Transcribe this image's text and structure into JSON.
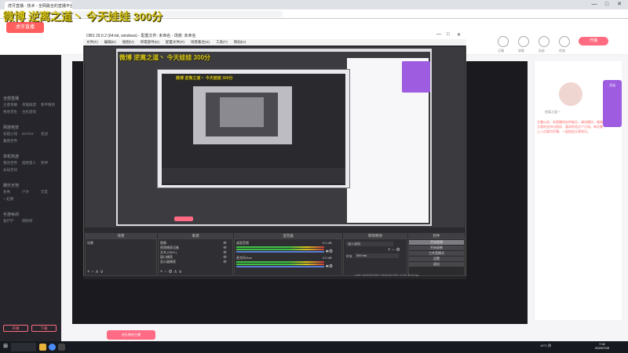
{
  "browser": {
    "tab_title": "虎牙直播 - 技术 - 全网最全的直播平台",
    "url": "huya.com/xxxxxx",
    "window_controls": [
      "—",
      "□",
      "✕"
    ]
  },
  "site": {
    "logo": "虎牙直播",
    "header_labels": [
      "订阅",
      "消息",
      "历史",
      "任务",
      "开播"
    ],
    "start_live_label": "开播"
  },
  "overlay": {
    "top_caption": "微博 逆离之道丶 今天娃娃 300分",
    "inner_caption": "微博 逆离之道丶 今天娃娃 300分",
    "inner_caption_small": "微博 逆离之道丶 今天娃娃 300分"
  },
  "sidebar": {
    "sections": [
      {
        "title": "全部直播",
        "items": [
          "王者荣耀",
          "英雄联盟",
          "和平精英",
          "绝地求生",
          "主机游戏"
        ]
      },
      {
        "title": "网游竞技",
        "items": [
          "穿越火线",
          "DOTA2",
          "逆战",
          "魔兽世界"
        ]
      },
      {
        "title": "单机热游",
        "items": [
          "我的世界",
          "怪物猎人",
          "原神",
          "永劫无间"
        ]
      },
      {
        "title": "娱乐天地",
        "items": [
          "星秀",
          "户外",
          "交友",
          "一起看"
        ]
      },
      {
        "title": "手游休闲",
        "items": [
          "金铲铲",
          "阴阳师"
        ]
      }
    ],
    "bottom_buttons": [
      "开播",
      "下载"
    ]
  },
  "obs": {
    "title": "OBS 29.0.2 (64-bit, windows) - 配置文件: 未命名 - 场景: 未命名",
    "menu": [
      "文件(F)",
      "编辑(E)",
      "视图(V)",
      "停靠部件(D)",
      "配置文件(P)",
      "场景集合(S)",
      "工具(T)",
      "帮助(H)"
    ],
    "docks": {
      "scenes_header": "场景",
      "sources_header": "来源",
      "mixer_header": "混音器",
      "transitions_header": "转场特效",
      "controls_header": "控件"
    },
    "scene_items": [
      "场景"
    ],
    "source_items": [
      "图像",
      "视频捕获设备",
      "文本 (GDI+)",
      "窗口捕获",
      "显示器捕获"
    ],
    "mixer": {
      "track1": "桌面音频",
      "track1_db": "0.0 dB",
      "track2": "麦克风/Aux",
      "track2_db": "0.0 dB"
    },
    "transitions": {
      "type": "淡入淡出",
      "duration_label": "时长",
      "duration_value": "300 ms"
    },
    "controls": [
      "开始直播",
      "开始录制",
      "工作室模式",
      "设置",
      "退出"
    ],
    "status": "LIVE: 00:00:00   REC: 00:00:00   CPU: 1.2%, 30.00 fps"
  },
  "right_panel": {
    "streamer_name": "逆离之道丶",
    "description": "主播公告：本直播间仅供娱乐，请勿模仿，感谢大家的支持与陪伴，喜欢的话点个订阅，每天晚上八点准时开播，一起娃娃分享快乐。"
  },
  "promo": {
    "label": "活动"
  },
  "bottom_pink_label": "送礼物给主播",
  "taskbar": {
    "weather": "19°C 阴",
    "time": "7:32",
    "date": "2023/7/28"
  },
  "colors": {
    "accent": "#ff5e5e",
    "overlay_text": "#d4c21a",
    "obs_bg": "#2b2b2e",
    "sidebar_bg": "#25252b"
  }
}
